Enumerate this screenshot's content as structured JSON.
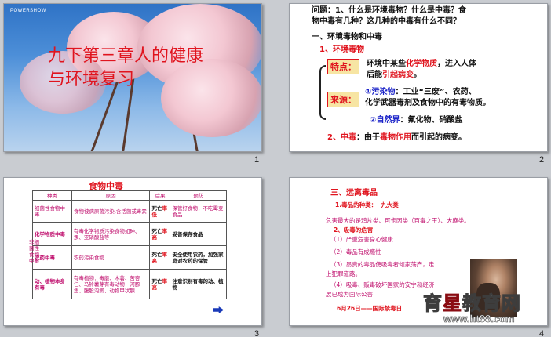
{
  "slides": [
    {
      "number": "1",
      "logo": "POWERSHOW",
      "title": "九下第三章人的健康与环境复习"
    },
    {
      "number": "2",
      "question_1": "问题：1、什么是环境毒物？什么是中毒？食",
      "question_2": "物中毒有几种？这几种的中毒有什么不同？",
      "section": "一、环境毒物和中毒",
      "sub1": "1、环境毒物",
      "tag_feature": "特点：",
      "feature_line1_a": "环境中某些",
      "feature_line1_b": "化学物质",
      "feature_line1_c": "，进入人体",
      "feature_line2_a": "后能",
      "feature_line2_b": "引起病变",
      "feature_line2_c": "。",
      "tag_source": "来源：",
      "pollutant_label": "①污染物",
      "pollutant_line1": "：工业“三废”、农药、",
      "pollutant_line2": "化学武器毒剂及食物中的有毒物质。",
      "natural_label": "②自然界",
      "natural_text": "：氟化物、硝酸盐",
      "sub2": "2、中毒",
      "sub2_text_a": "：由于",
      "sub2_text_b": "毒物作用",
      "sub2_text_c": "而引起的病变。"
    },
    {
      "number": "3",
      "title": "食物中毒",
      "headers": [
        "种类",
        "原因",
        "后果",
        "预防"
      ],
      "side_label": "非细菌性食物中毒",
      "rows": [
        {
          "kind": "细菌性食物中毒",
          "cause": "食物被病原菌污染,含活菌或毒素",
          "result_a": "死亡",
          "result_b": "率低",
          "prevention": "保管好食物，不吃霉变食品"
        },
        {
          "kind": "化学物质中毒",
          "cause": "有毒化学物质污染食物如砷、汞、亚硝酸盐等",
          "result_a": "死亡",
          "result_b": "率高",
          "prevention": "妥善保存食品"
        },
        {
          "kind": "农药中毒",
          "cause": "农药污染食物",
          "result_a": "死亡",
          "result_b": "率高",
          "prevention": "安全使用农药，加强家庭对农药的保管"
        },
        {
          "kind": "动、植物本身有毒",
          "cause": "有毒植物：毒蘑、木薯、苦杏仁、马铃薯芽有毒动物：河豚鱼、腹股沟鲫、动物甲状腺",
          "result_a": "死亡",
          "result_b": "率高",
          "prevention": "注意识别有毒的动、植物"
        }
      ]
    },
    {
      "number": "4",
      "section": "三、远离毒品",
      "sub1": "1.毒品的种类：",
      "sub1_value": "九大类",
      "line_danger": "危害最大的是鸦片类、可卡因类（百毒之王）、大麻类。",
      "sub2": "2、吸毒的危害",
      "item1": "（1）严重危害身心健康",
      "item2": "（2）毒品有成瘾性",
      "item3_a": "（3）昂贵的毒品使吸毒者倾家荡产，走",
      "item3_b": "上犯罪道路。",
      "item4_a": "（4）吸毒、贩毒破坏国家的安宁和经济",
      "item4_b": "展已成为国际公害",
      "date_line": "6月26日——国际禁毒日",
      "watermark_a": "育",
      "watermark_star": "星",
      "watermark_b": "教育网",
      "watermark_url": "www.ht88.com"
    }
  ],
  "colors": {
    "accent_red": "#e0141e",
    "text_magenta": "#c0106e",
    "text_blue": "#1a22c8",
    "tag_bg": "#f7e5a3"
  }
}
